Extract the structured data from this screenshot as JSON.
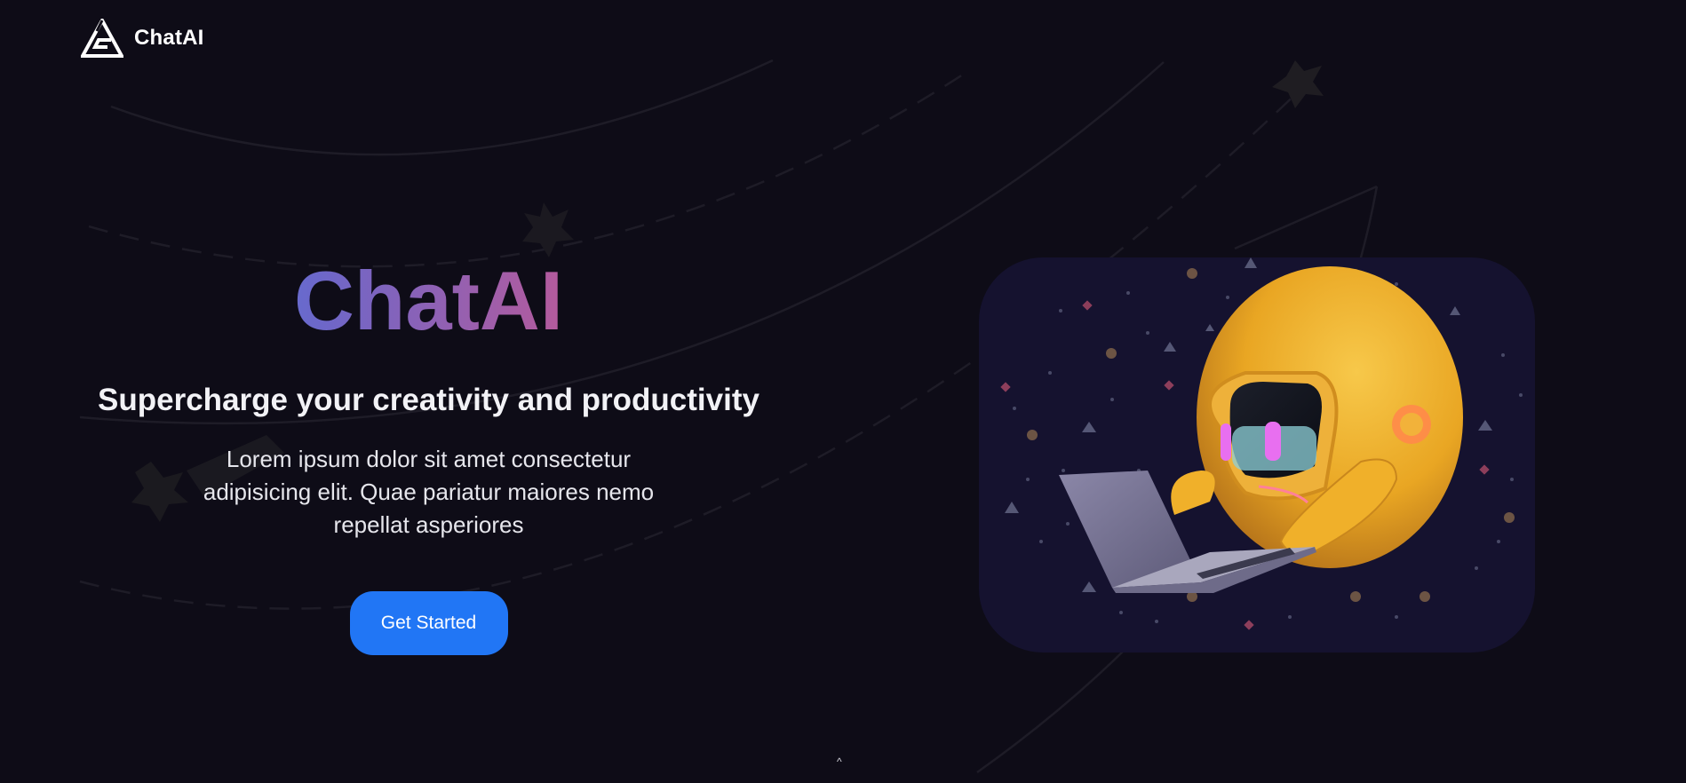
{
  "nav": {
    "logo_icon": "triangle-logo-icon",
    "brand": "ChatAI"
  },
  "hero": {
    "title": "ChatAI",
    "title_gradient": [
      "#3d85f0",
      "#6d67c9",
      "#b75a9b",
      "#ec4864"
    ],
    "subtitle": "Supercharge your creativity and productivity",
    "description": "Lorem ipsum dolor sit amet consectetur adipisicing elit. Quae pariatur maiores nemo repellat asperiores",
    "cta_label": "Get Started",
    "image_icon": "robot-laptop-illustration"
  },
  "colors": {
    "background": "#0e0c17",
    "cta": "#2176f5",
    "image_panel": "#15122f",
    "robot": "#f0b02a"
  },
  "scroll_indicator": "^"
}
